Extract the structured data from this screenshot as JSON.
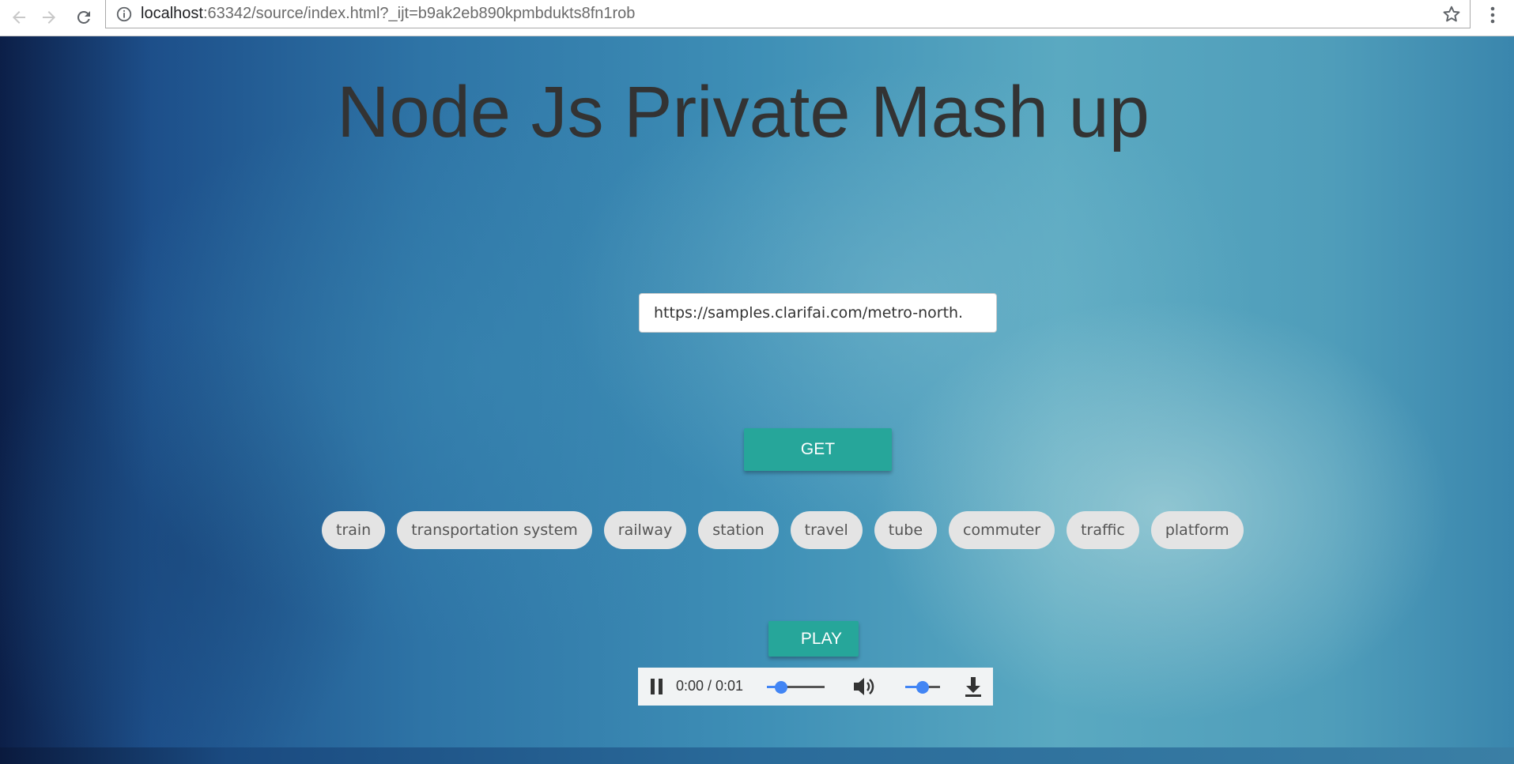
{
  "browser": {
    "url_host": "localhost",
    "url_rest": ":63342/source/index.html?_ijt=b9ak2eb890kpmbdukts8fn1rob"
  },
  "page": {
    "title": "Node Js Private Mash up",
    "url_input_value": "https://samples.clarifai.com/metro-north.",
    "get_label": "GET",
    "play_label": "PLAY",
    "tags": [
      "train",
      "transportation system",
      "railway",
      "station",
      "travel",
      "tube",
      "commuter",
      "traffic",
      "platform"
    ]
  },
  "audio_player": {
    "time_display": "0:00 / 0:01",
    "progress_fraction": 0.25,
    "volume_fraction": 0.5
  },
  "colors": {
    "button": "#26a69a",
    "tag_bg": "#e4e4e4",
    "slider": "#4285f4"
  },
  "icons": [
    "back-arrow-icon",
    "forward-arrow-icon",
    "reload-icon",
    "info-icon",
    "star-icon",
    "menu-dots-icon",
    "pause-icon",
    "volume-icon",
    "download-icon"
  ]
}
